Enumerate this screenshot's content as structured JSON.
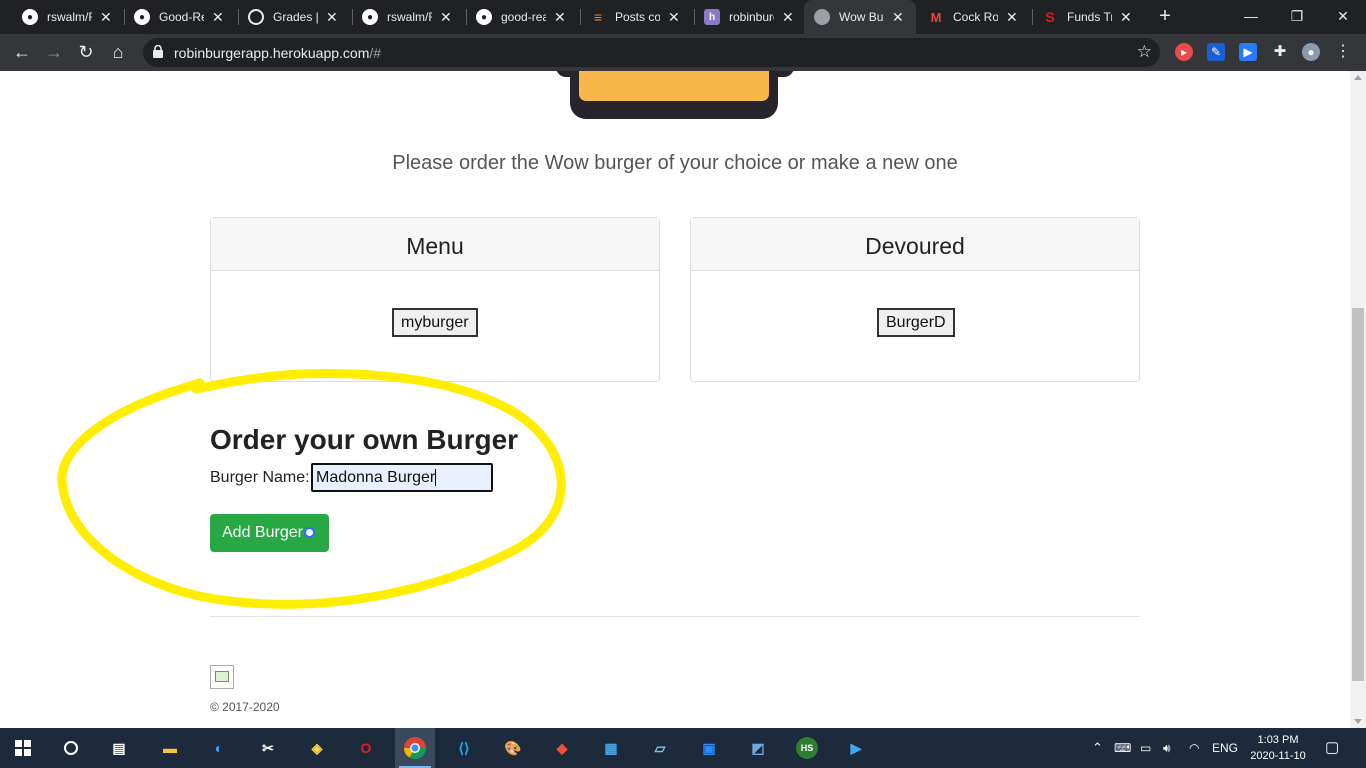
{
  "browser": {
    "tabs": [
      {
        "title": "rswalm/R",
        "icon": "github-icon",
        "color": "#ffffff"
      },
      {
        "title": "Good-Re",
        "icon": "github-icon",
        "color": "#ffffff"
      },
      {
        "title": "Grades |",
        "icon": "globe-icon",
        "color": "#ffffff"
      },
      {
        "title": "rswalm/R",
        "icon": "github-icon",
        "color": "#ffffff"
      },
      {
        "title": "good-rea",
        "icon": "github-icon",
        "color": "#ffffff"
      },
      {
        "title": "Posts cor",
        "icon": "stackoverflow-icon",
        "color": "#f48024"
      },
      {
        "title": "robinburg",
        "icon": "heroku-icon",
        "color": "#8a79c7"
      },
      {
        "title": "Wow Bur",
        "icon": "globe-icon",
        "color": "#9aa0a6"
      },
      {
        "title": "Cock Roa",
        "icon": "gmail-icon",
        "color": "#ea4335"
      },
      {
        "title": "Funds Tra",
        "icon": "scotiabank-icon",
        "color": "#ec111a"
      }
    ],
    "url_host": "robinburgerapp.herokuapp.com",
    "url_path": "/#"
  },
  "page": {
    "tagline": "Please order the Wow burger of your choice or make a new one",
    "menu": {
      "header": "Menu",
      "items": [
        "myburger"
      ]
    },
    "devoured": {
      "header": "Devoured",
      "items": [
        "BurgerD"
      ]
    },
    "form": {
      "title": "Order your own Burger",
      "label": "Burger Name:",
      "value": "Madonna Burger",
      "button": "Add Burger"
    },
    "footer": {
      "copyright": "© 2017-2020"
    },
    "colors": {
      "highlight": "#ffee00",
      "add_button": "#28a745",
      "burger_bun": "#f9b74b"
    }
  },
  "taskbar": {
    "language": "ENG",
    "time": "1:03 PM",
    "date": "2020-11-10"
  }
}
